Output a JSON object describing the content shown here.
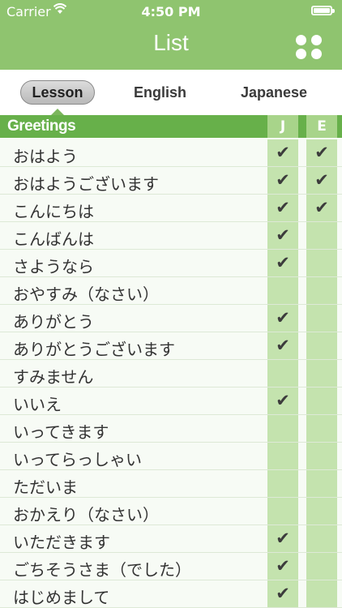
{
  "status": {
    "carrier": "Carrier",
    "time": "4:50 PM",
    "battery_level": 1.0
  },
  "header": {
    "title": "List",
    "menu_icon": "grid-dots-icon"
  },
  "segments": [
    "Lesson",
    "English",
    "Japanese"
  ],
  "selected_segment": "Lesson",
  "section": {
    "title": "Greetings",
    "col_j": "J",
    "col_e": "E"
  },
  "check_mark": "✔",
  "rows": [
    {
      "text": "おはよう",
      "j": true,
      "e": true
    },
    {
      "text": "おはようございます",
      "j": true,
      "e": true
    },
    {
      "text": "こんにちは",
      "j": true,
      "e": true
    },
    {
      "text": "こんばんは",
      "j": true,
      "e": false
    },
    {
      "text": "さようなら",
      "j": true,
      "e": false
    },
    {
      "text": "おやすみ（なさい）",
      "j": false,
      "e": false
    },
    {
      "text": "ありがとう",
      "j": true,
      "e": false
    },
    {
      "text": "ありがとうございます",
      "j": true,
      "e": false
    },
    {
      "text": "すみません",
      "j": false,
      "e": false
    },
    {
      "text": "いいえ",
      "j": true,
      "e": false
    },
    {
      "text": "いってきます",
      "j": false,
      "e": false
    },
    {
      "text": "いってらっしゃい",
      "j": false,
      "e": false
    },
    {
      "text": "ただいま",
      "j": false,
      "e": false
    },
    {
      "text": "おかえり（なさい）",
      "j": false,
      "e": false
    },
    {
      "text": "いただきます",
      "j": true,
      "e": false
    },
    {
      "text": "ごちそうさま（でした）",
      "j": true,
      "e": false
    },
    {
      "text": "はじめまして",
      "j": true,
      "e": false
    }
  ],
  "colors": {
    "header": "#8fc46f",
    "section": "#67b04a",
    "cell": "#c4e3ae"
  }
}
